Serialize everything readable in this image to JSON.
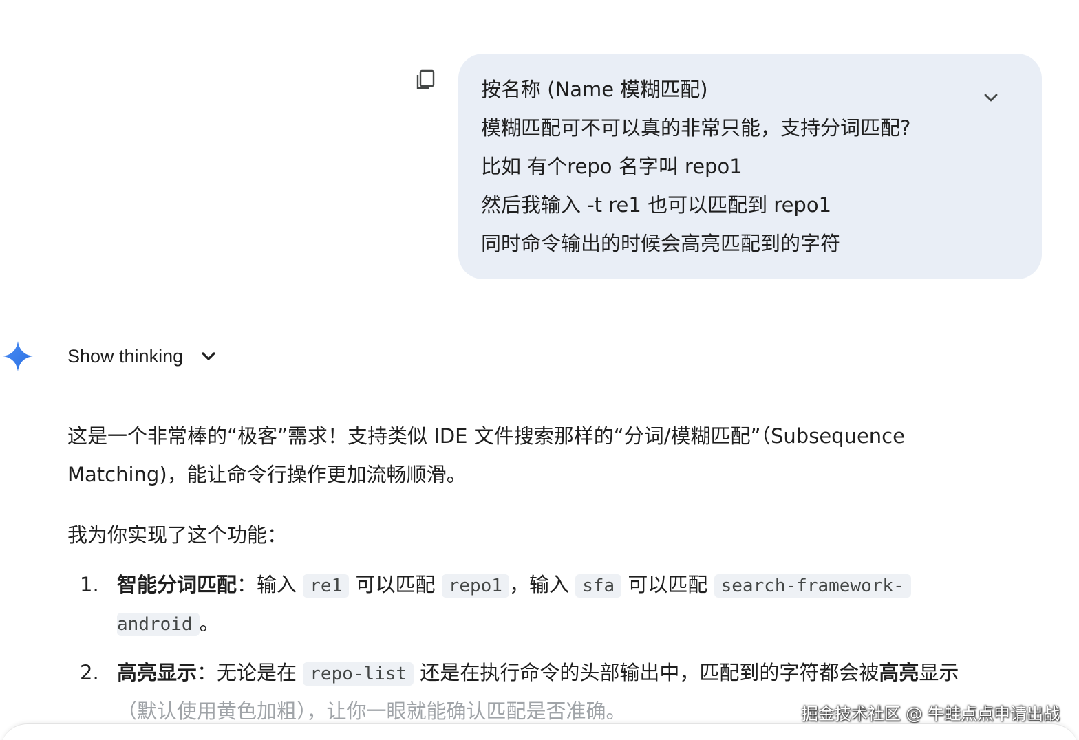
{
  "user_message": {
    "lines": [
      "按名称 (Name 模糊匹配)",
      "模糊匹配可不可以真的非常只能，支持分词匹配?",
      "比如 有个repo 名字叫 repo1",
      "然后我输入 -t re1 也可以匹配到 repo1",
      "同时命令输出的时候会高亮匹配到的字符"
    ],
    "copy_icon": "copy-icon",
    "expand_icon": "chevron-down-icon"
  },
  "assistant": {
    "logo_icon": "gemini-sparkle-icon",
    "show_thinking_label": "Show thinking",
    "intro_line1": "这是一个非常棒的“极客”需求！支持类似 IDE 文件搜索那样的“分词/模糊匹配”（Subsequence",
    "intro_line2": "Matching)，能让命令行操作更加流畅顺滑。",
    "intro2": "我为你实现了这个功能：",
    "list": [
      {
        "num": "1.",
        "title": "智能分词匹配",
        "sep": "：",
        "t1": "输入",
        "c1": "re1",
        "t2": "可以匹配",
        "c2": "repo1",
        "t3": "，输入",
        "c3": "sfa",
        "t4": "可以匹配",
        "c4a": "search-framework-",
        "c4b": "android",
        "end": "。"
      },
      {
        "num": "2.",
        "title": "高亮显示",
        "sep": "：",
        "t1": "无论是在",
        "c1": "repo-list",
        "t2": "还是在执行命令的头部输出中，匹配到的字符都会被",
        "bold2": "高亮",
        "t3": "显示",
        "line2": "（默认使用黄色加粗），让你一眼就能确认匹配是否准确。"
      }
    ]
  },
  "watermark": "掘金技术社区 @ 牛蛙点点申请出战"
}
